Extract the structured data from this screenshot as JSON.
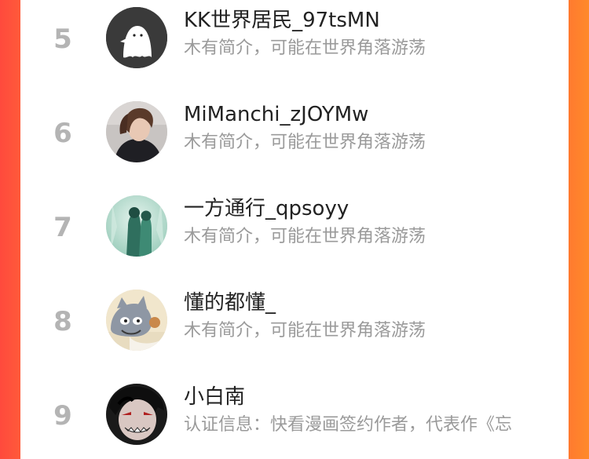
{
  "ranking": {
    "items": [
      {
        "rank": "5",
        "name": "KK世界居民_97tsMN",
        "bio": "木有简介，可能在世界角落游荡",
        "avatar_icon": "ghost-avatar-icon"
      },
      {
        "rank": "6",
        "name": "MiManchi_zJOYMw",
        "bio": "木有简介，可能在世界角落游荡",
        "avatar_icon": "anime-boy-avatar-icon"
      },
      {
        "rank": "7",
        "name": "一方通行_qpsoyy",
        "bio": "木有简介，可能在世界角落游荡",
        "avatar_icon": "couple-avatar-icon"
      },
      {
        "rank": "8",
        "name": "懂的都懂_",
        "bio": "木有简介，可能在世界角落游荡",
        "avatar_icon": "cartoon-cat-avatar-icon"
      },
      {
        "rank": "9",
        "name": "小白南",
        "bio": "认证信息：快看漫画签约作者，代表作《忘",
        "avatar_icon": "dark-character-avatar-icon"
      }
    ]
  },
  "colors": {
    "left_edge": "#ff4a3d",
    "right_edge": "#ff7a2f",
    "rank_text": "#b4b4b4",
    "name_text": "#222222",
    "bio_text": "#9a9a9a"
  }
}
